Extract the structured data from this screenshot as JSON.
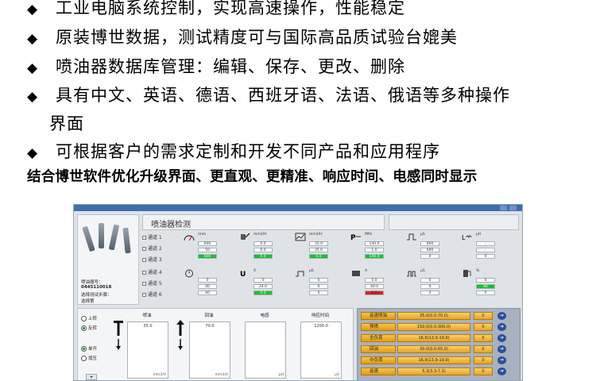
{
  "bullets": [
    "工业电脑系统控制，实现高速操作，性能稳定",
    "原装博世数据，测试精度可与国际高品质试验台媲美",
    "喷油器数据库管理：编辑、保存、更改、删除",
    "具有中文、英语、德语、西班牙语、法语、俄语等多种操作",
    "可根据客户的需求定制和开发不同产品和应用程序"
  ],
  "bullet_continuation": "界面",
  "bullet_marker": "◆",
  "summary": "结合博世软件优化升级界面、更直观、更精准、响应时间、电感同时显示",
  "app": {
    "title": "喷油器检测",
    "left_info": [
      "喷油器号：",
      "0445110018",
      "选择测试步骤：",
      "选择第"
    ],
    "channels": [
      "通道 1",
      "通道 2",
      "通道 3",
      "通道 4",
      "通道 5",
      "通道 6"
    ],
    "cells_top": [
      {
        "hdr": "/mm",
        "rows": [
          [
            "",
            "600"
          ],
          [
            "",
            "50"
          ],
          [
            "",
            "600"
          ]
        ]
      },
      {
        "hdr": "mm3/H",
        "rows": [
          [
            "",
            "0.0"
          ],
          [
            "",
            "0.0"
          ],
          [
            "",
            "0.0"
          ]
        ]
      },
      {
        "hdr": "mm3/H",
        "rows": [
          [
            "",
            "35.0"
          ],
          [
            "",
            "35.0"
          ],
          [
            "",
            "0.0"
          ]
        ]
      },
      {
        "hdr": "MPa",
        "rows": [
          [
            "",
            "140.0"
          ],
          [
            "",
            "1.0"
          ],
          [
            "",
            "140.0"
          ]
        ]
      },
      {
        "hdr": "μS",
        "rows": [
          [
            "",
            "800"
          ],
          [
            "",
            "400"
          ],
          [
            "",
            "0"
          ]
        ]
      },
      {
        "hdr": "μH",
        "rows": [
          [
            "",
            "-"
          ],
          [
            "",
            "-"
          ],
          [
            "",
            "0"
          ]
        ]
      }
    ],
    "cells_bottom": [
      {
        "hdr": "",
        "rows": [
          [
            "",
            "0"
          ],
          [
            "",
            "40"
          ],
          [
            "",
            "40"
          ]
        ]
      },
      {
        "hdr": "V",
        "rows": [
          [
            "",
            "0"
          ],
          [
            "",
            "24.0"
          ],
          [
            "",
            "0.0"
          ]
        ]
      },
      {
        "hdr": "μS",
        "rows": [
          [
            "",
            "0"
          ],
          [
            "",
            "0"
          ],
          [
            "",
            "0"
          ]
        ]
      },
      {
        "hdr": "A",
        "rows": [
          [
            "",
            "0.0"
          ],
          [
            "",
            "40.0"
          ],
          [
            "",
            "2.0"
          ]
        ]
      },
      {
        "hdr": "μS",
        "rows": [
          [
            "",
            "0"
          ],
          [
            "",
            "0"
          ],
          [
            "",
            "0"
          ]
        ]
      },
      {
        "hdr": "%",
        "rows": [
          [
            "",
            "0"
          ],
          [
            "",
            "90"
          ],
          [
            "",
            "0"
          ]
        ]
      }
    ],
    "radios": [
      "上转",
      "反转",
      "单开",
      "增压"
    ],
    "plus_label": "+",
    "meters": [
      {
        "label": "喷油",
        "value": "35.0",
        "unit": "mm3/H"
      },
      {
        "label": "回油",
        "value": "70.0",
        "unit": "mm3/H"
      },
      {
        "label": "电感",
        "value": "",
        "unit": "μH"
      },
      {
        "label": "响应时间",
        "value": "1200.0",
        "unit": "μS"
      }
    ],
    "range_rows": [
      {
        "name": "怠速喷油",
        "range": "35.0(0.0-70.0)",
        "zero": "0"
      },
      {
        "name": "预喷",
        "range": "150.0(0.0-300.0)",
        "zero": "0"
      },
      {
        "name": "全负荷",
        "range": "16.9(13.9-19.9)",
        "zero": "0"
      },
      {
        "name": "回油",
        "range": "30.0(0.0-55.0)",
        "zero": "0"
      },
      {
        "name": "中负荷",
        "range": "16.9(13.9-19.9)",
        "zero": "0"
      },
      {
        "name": "怠速",
        "range": "5.3(3.3-7.3)",
        "zero": "0"
      }
    ],
    "go_icon": "➔"
  }
}
